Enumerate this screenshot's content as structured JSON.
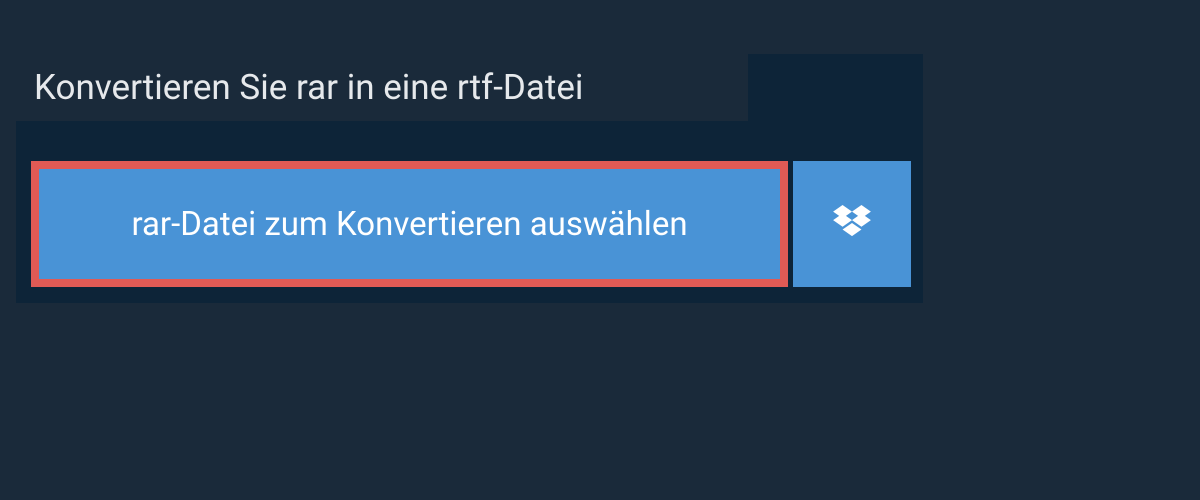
{
  "title": "Konvertieren Sie rar in eine rtf-Datei",
  "selectFileLabel": "rar-Datei zum Konvertieren auswählen"
}
